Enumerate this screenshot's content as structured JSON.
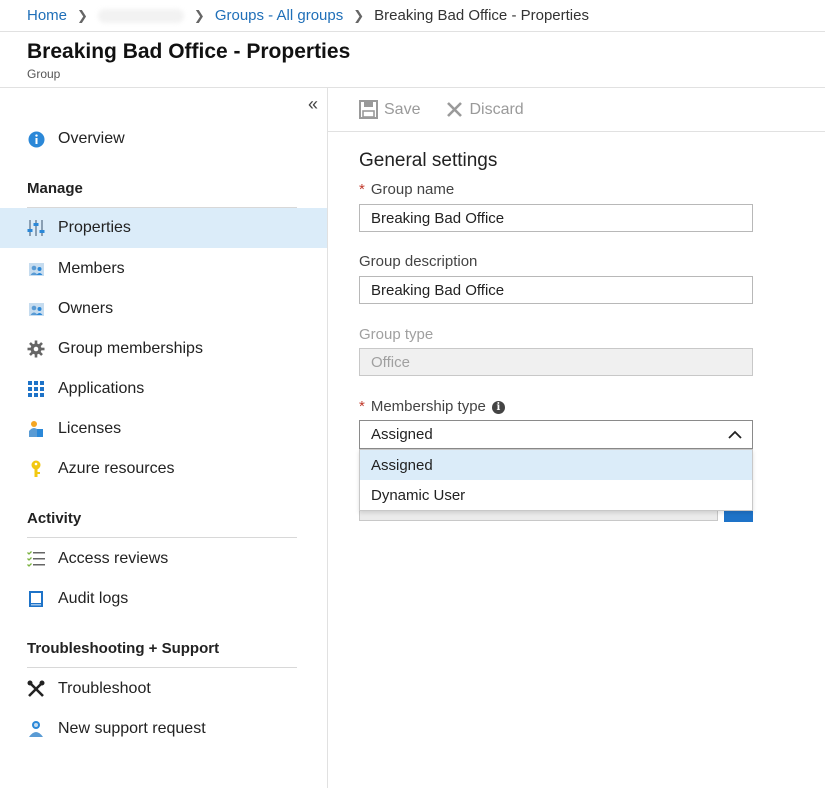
{
  "breadcrumb": {
    "home": "Home",
    "groups": "Groups - All groups",
    "current": "Breaking Bad Office - Properties"
  },
  "header": {
    "title": "Breaking Bad Office - Properties",
    "subtitle": "Group"
  },
  "sidebar": {
    "collapse_label": "«",
    "overview": "Overview",
    "manage_heading": "Manage",
    "manage_items": [
      "Properties",
      "Members",
      "Owners",
      "Group memberships",
      "Applications",
      "Licenses",
      "Azure resources"
    ],
    "activity_heading": "Activity",
    "activity_items": [
      "Access reviews",
      "Audit logs"
    ],
    "troubleshoot_heading": "Troubleshooting + Support",
    "troubleshoot_items": [
      "Troubleshoot",
      "New support request"
    ]
  },
  "toolbar": {
    "save_label": "Save",
    "discard_label": "Discard"
  },
  "form": {
    "section_title": "General settings",
    "required_mark": "*",
    "group_name_label": "Group name",
    "group_name_value": "Breaking Bad Office",
    "group_description_label": "Group description",
    "group_description_value": "Breaking Bad Office",
    "group_type_label": "Group type",
    "group_type_value": "Office",
    "membership_type_label": "Membership type",
    "membership_type_info": "i",
    "membership_type_value": "Assigned",
    "membership_options": [
      "Assigned",
      "Dynamic User"
    ]
  },
  "colors": {
    "accent": "#1e73c8",
    "link": "#1f6fb8",
    "selected_bg": "#dbecf9",
    "required": "#c0392b"
  }
}
